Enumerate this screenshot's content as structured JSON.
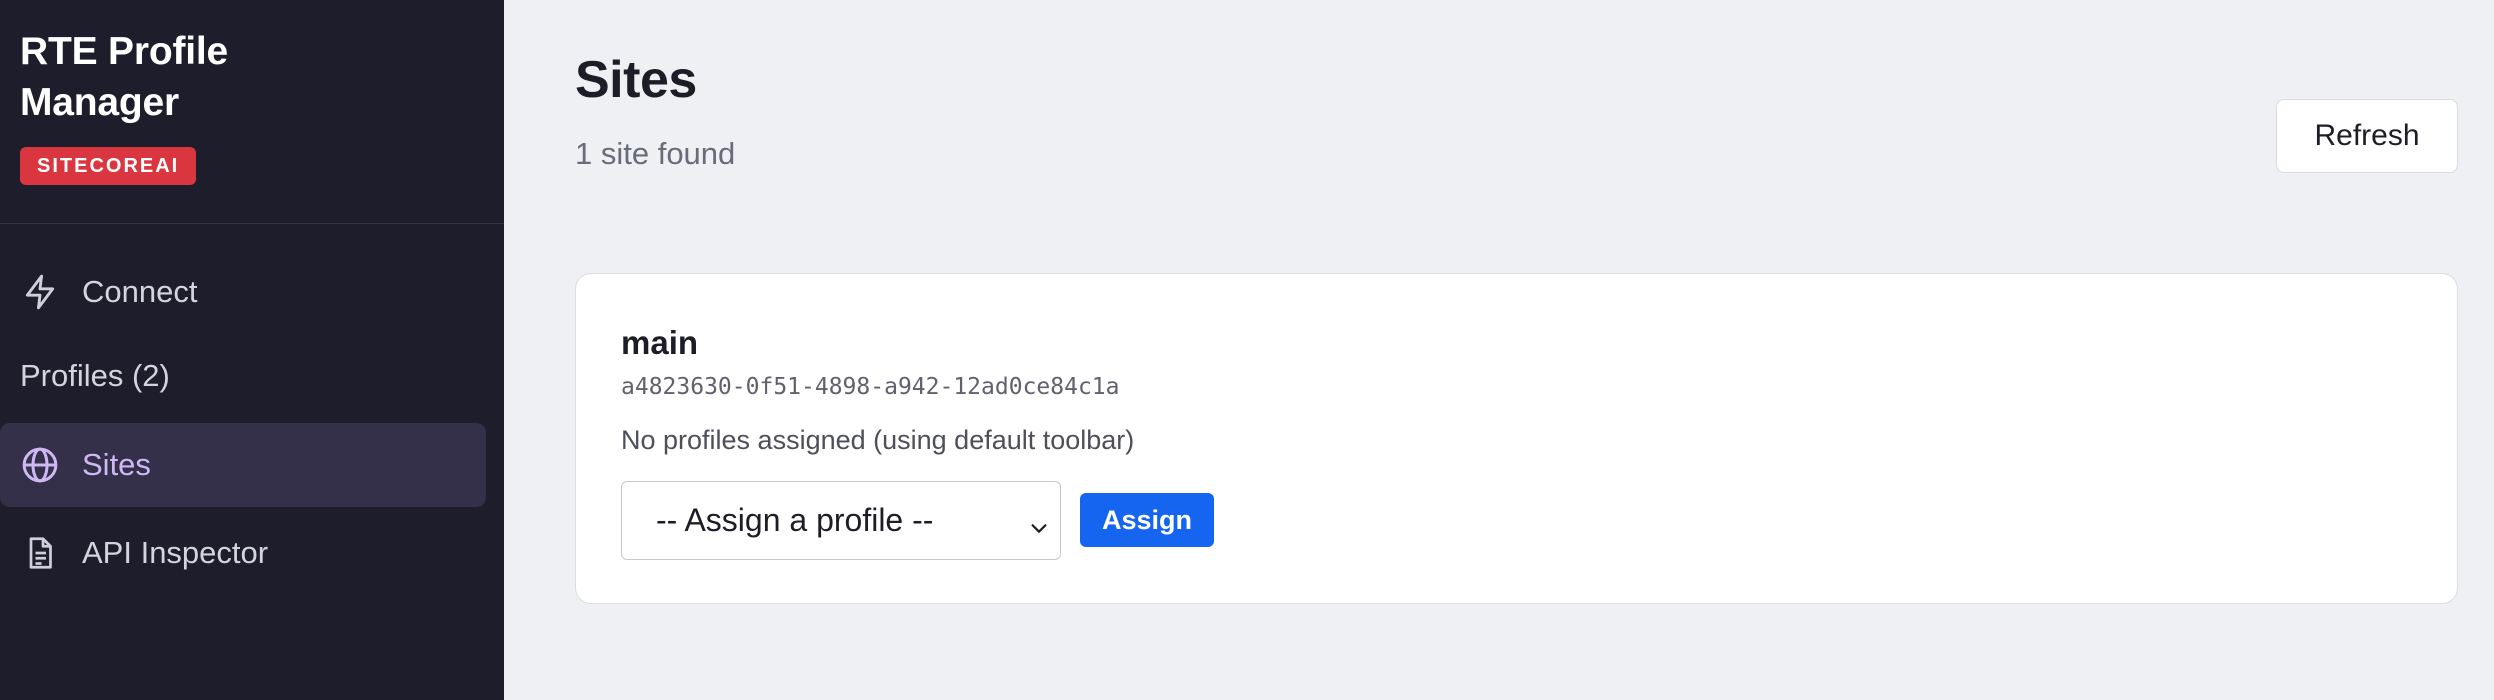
{
  "app": {
    "title_line1": "RTE Profile",
    "title_line2": "Manager",
    "badge": "SITECOREAI"
  },
  "nav": {
    "items": [
      {
        "label": "Connect",
        "icon": "lightning-icon",
        "active": false
      },
      {
        "label": "Profiles (2)",
        "icon": "",
        "active": false
      },
      {
        "label": "Sites",
        "icon": "globe-icon",
        "active": true
      },
      {
        "label": "API Inspector",
        "icon": "document-icon",
        "active": false
      }
    ]
  },
  "header": {
    "title": "Sites",
    "subtitle": "1 site found",
    "refresh_label": "Refresh"
  },
  "site": {
    "name": "main",
    "id": "a4823630-0f51-4898-a942-12ad0ce84c1a",
    "status": "No profiles assigned (using default toolbar)",
    "select_value": "-- Assign a profile --",
    "assign_label": "Assign"
  },
  "colors": {
    "sidebar_bg": "#1e1d2b",
    "active_nav_bg": "#35304a",
    "active_nav_text": "#cfb8f3",
    "badge_bg": "#d93640",
    "primary_button": "#1565f0",
    "page_bg": "#eff0f4"
  }
}
